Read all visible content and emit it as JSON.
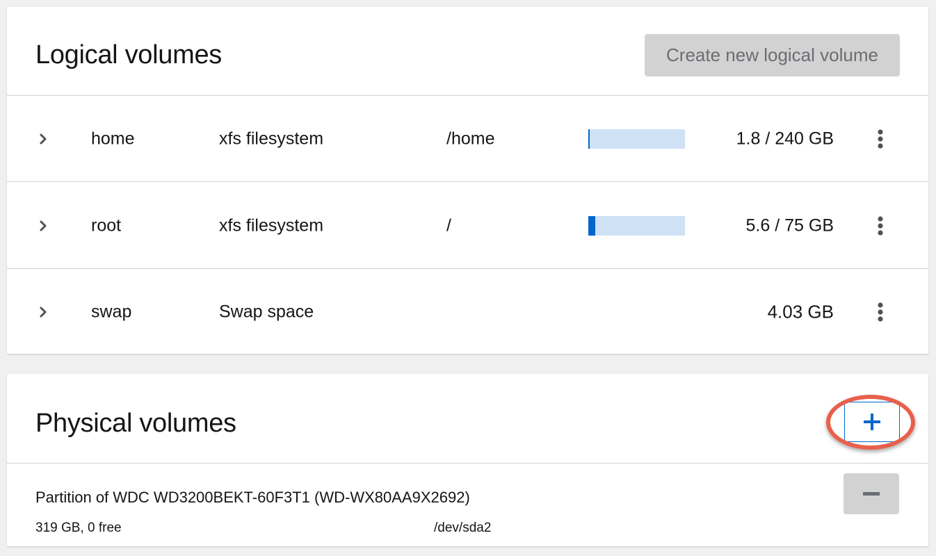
{
  "logical_volumes": {
    "title": "Logical volumes",
    "create_button": "Create new logical volume",
    "rows": [
      {
        "name": "home",
        "type": "xfs filesystem",
        "mount": "/home",
        "size": "1.8 / 240 GB",
        "usage_fraction": 0.0075
      },
      {
        "name": "root",
        "type": "xfs filesystem",
        "mount": "/",
        "size": "5.6 / 75 GB",
        "usage_fraction": 0.075
      },
      {
        "name": "swap",
        "type": "Swap space",
        "mount": "",
        "size": "4.03 GB",
        "usage_fraction": null
      }
    ]
  },
  "physical_volumes": {
    "title": "Physical volumes",
    "items": [
      {
        "name": "Partition of WDC WD3200BEKT-60F3T1 (WD-WX80AA9X2692)",
        "size_info": "319 GB, 0 free",
        "device": "/dev/sda2"
      }
    ]
  },
  "icons": {
    "expand": "chevron-right-icon",
    "menu": "kebab-menu-icon",
    "add": "plus-icon",
    "remove": "minus-icon"
  },
  "colors": {
    "accent": "#0066cc",
    "bar_track": "#cfe1f5",
    "disabled_button": "#d2d2d2",
    "highlight_ring": "#e8604c"
  }
}
